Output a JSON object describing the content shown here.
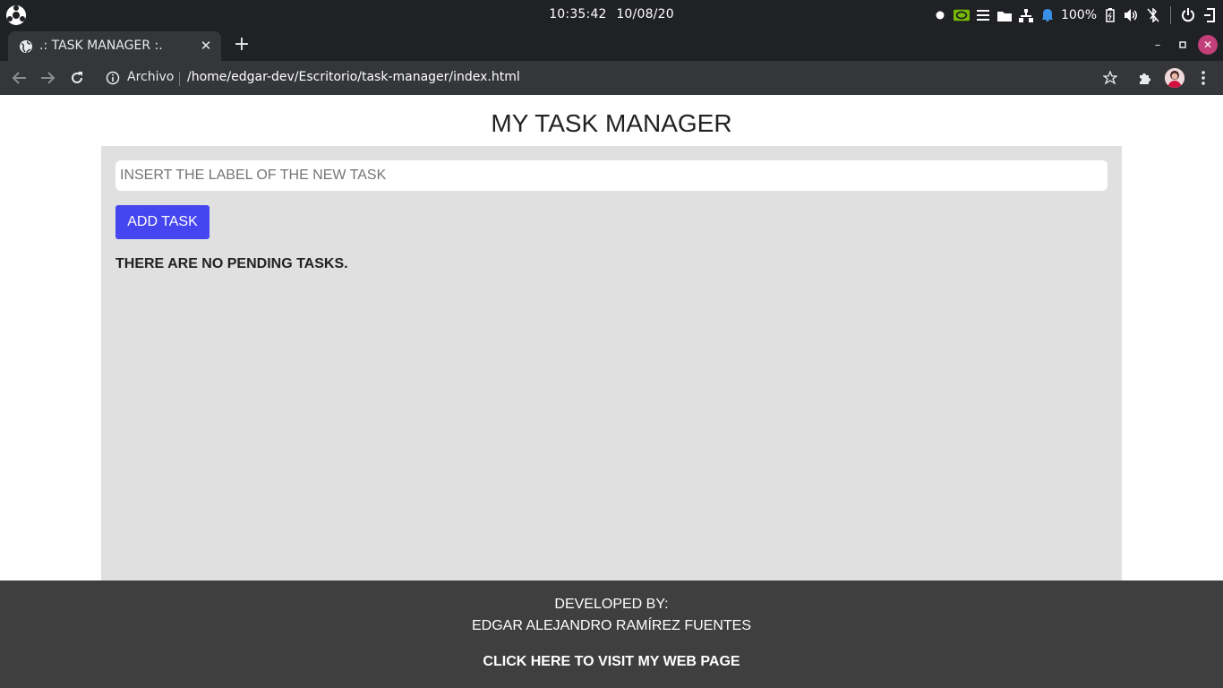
{
  "system_panel": {
    "time": "10:35:42",
    "date": "10/08/20",
    "battery_percent": "100%",
    "icons": [
      "os-logo-icon",
      "record-dot-icon",
      "nvidia-icon",
      "menu-icon",
      "folder-icon",
      "network-icon",
      "notification-icon",
      "battery-icon",
      "volume-icon",
      "bluetooth-off-icon",
      "power-icon",
      "logout-icon"
    ]
  },
  "browser": {
    "tab_title": ".: TASK MANAGER :.",
    "address_scheme": "Archivo",
    "address_url": "/home/edgar-dev/Escritorio/task-manager/index.html",
    "colors": {
      "frame": "#202124",
      "toolbar": "#35363a",
      "close_button": "#c23f7a"
    }
  },
  "app": {
    "title": "MY TASK MANAGER",
    "input_placeholder": "INSERT THE LABEL OF THE NEW TASK",
    "input_value": "",
    "add_button_label": "ADD TASK",
    "empty_message": "THERE ARE NO PENDING TASKS.",
    "colors": {
      "container": "#e0e0e0",
      "button": "#4646f0",
      "footer": "#3f3f3f"
    }
  },
  "footer": {
    "developed_by": "DEVELOPED BY:",
    "developer_name": "EDGAR ALEJANDRO RAMÍREZ FUENTES",
    "link_text": "CLICK HERE TO VISIT MY WEB PAGE"
  }
}
